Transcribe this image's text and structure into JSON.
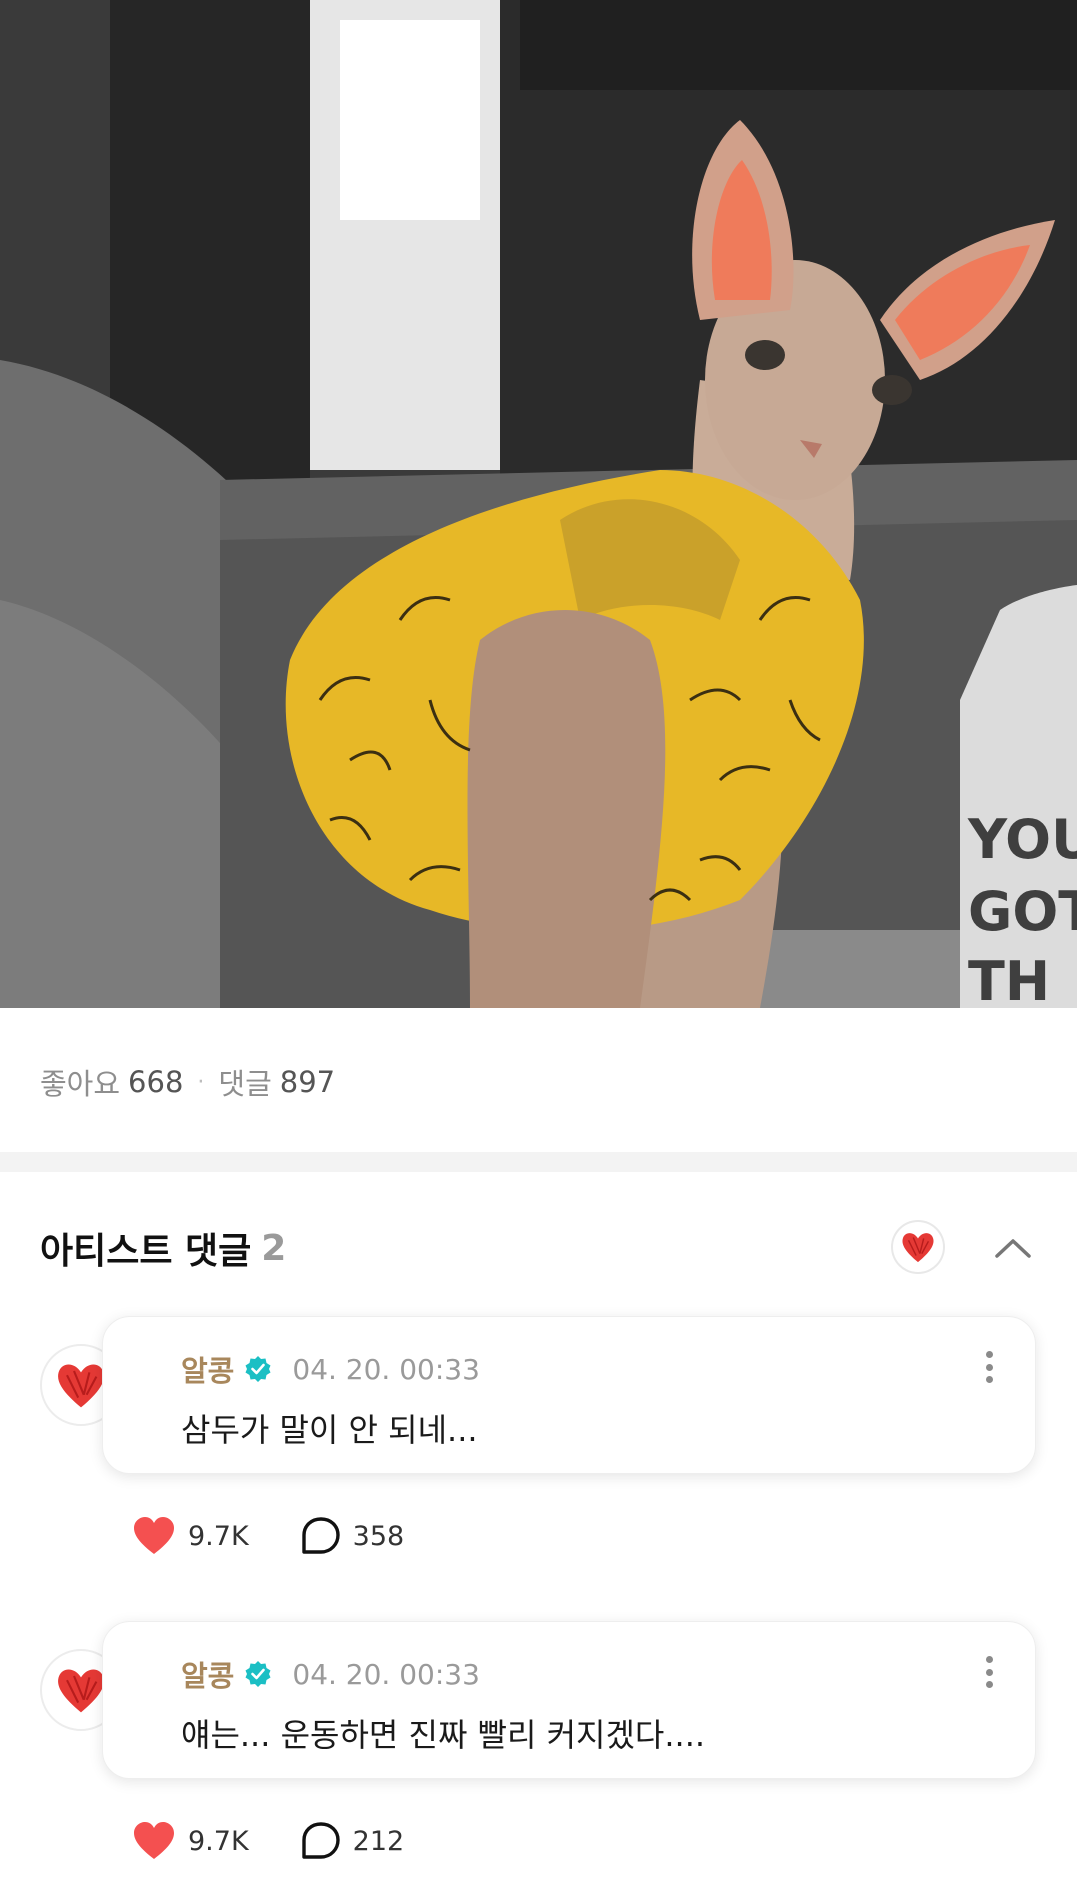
{
  "post": {
    "photo_alt": "sphynx-cat-photo",
    "bottle_text": [
      "YOU",
      "GOT",
      "TH"
    ]
  },
  "stats": {
    "likes_label": "좋아요",
    "likes_count": "668",
    "separator": "·",
    "comments_label": "댓글",
    "comments_count": "897"
  },
  "artist_comments": {
    "title": "아티스트 댓글",
    "count": "2",
    "items": [
      {
        "author": "알콩",
        "timestamp": "04. 20. 00:33",
        "text": "삼두가 말이 안 되네...",
        "likes": "9.7K",
        "replies": "358"
      },
      {
        "author": "알콩",
        "timestamp": "04. 20. 00:33",
        "text": "얘는... 운동하면 진짜 빨리 커지겠다....",
        "likes": "9.7K",
        "replies": "212"
      }
    ]
  },
  "colors": {
    "author": "#a8875c",
    "verified": "#1bbfc4",
    "heart": "#f45050",
    "avatar_heart": "#e53935"
  },
  "icons": [
    "heart-icon",
    "speech-bubble-icon",
    "verified-badge-icon",
    "more-vertical-icon",
    "chevron-up-icon"
  ]
}
